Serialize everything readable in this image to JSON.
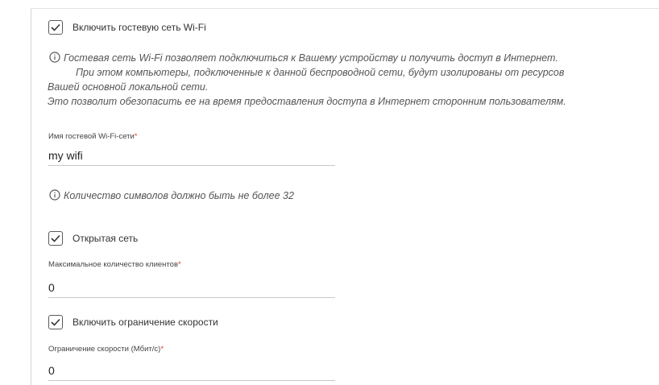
{
  "guest": {
    "enable_label": "Включить гостевую сеть Wi-Fi",
    "enable_checked": true,
    "info_lines": [
      "Гостевая сеть Wi-Fi позволяет подключиться к Вашему устройству и получить доступ в Интернет.",
      "При этом компьютеры, подключенные к данной беспроводной сети, будут изолированы от ресурсов",
      "Вашей основной локальной сети.",
      "Это позволит обезопасить ее на время предоставления доступа в Интернет сторонним пользователям."
    ],
    "ssid_label": "Имя гостевой Wi-Fi-сети",
    "ssid_value": "my wifi",
    "ssid_hint": "Количество символов должно быть не более 32",
    "open_label": "Открытая сеть",
    "open_checked": true,
    "max_clients_label": "Максимальное количество клиентов",
    "max_clients_value": "0",
    "speed_limit_label": "Включить ограничение скорости",
    "speed_limit_checked": true,
    "speed_label": "Ограничение скорости (Мбит/с)",
    "speed_value": "0",
    "required_mark": "*"
  }
}
